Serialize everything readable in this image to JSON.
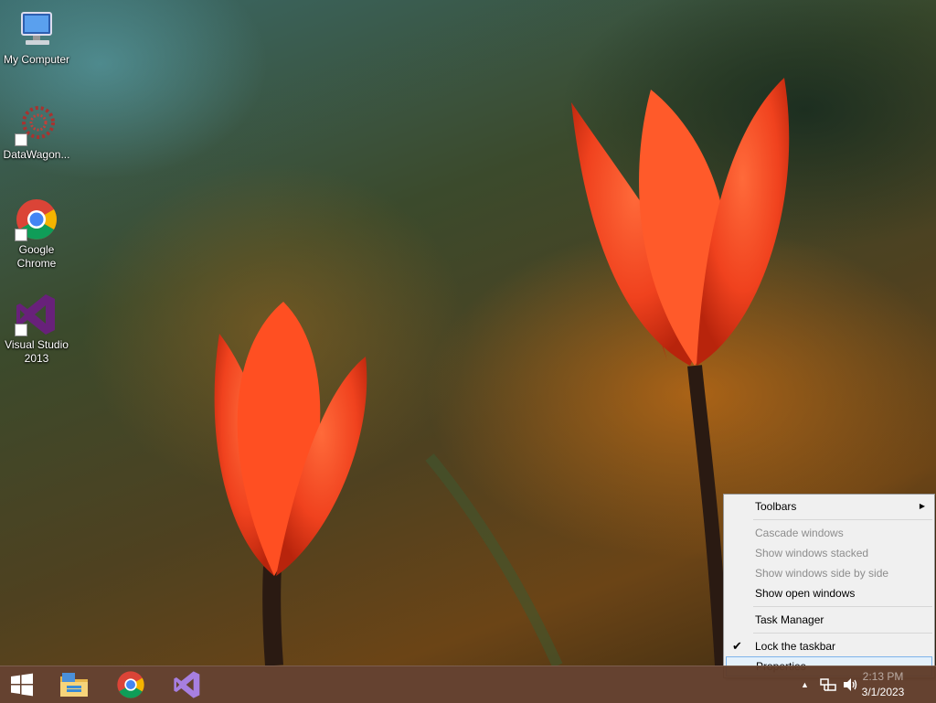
{
  "desktop": {
    "icons": [
      {
        "label": "My Computer"
      },
      {
        "label": "DataWagon..."
      },
      {
        "label": "Google Chrome"
      },
      {
        "label": "Visual Studio 2013"
      }
    ]
  },
  "context_menu": {
    "items": [
      {
        "label": "Toolbars",
        "enabled": true,
        "submenu": true
      },
      {
        "label": "Cascade windows",
        "enabled": false
      },
      {
        "label": "Show windows stacked",
        "enabled": false
      },
      {
        "label": "Show windows side by side",
        "enabled": false
      },
      {
        "label": "Show open windows",
        "enabled": true
      },
      {
        "label": "Task Manager",
        "enabled": true
      },
      {
        "label": "Lock the taskbar",
        "enabled": true,
        "checked": true
      },
      {
        "label": "Properties",
        "enabled": true,
        "highlighted": true
      }
    ]
  },
  "taskbar": {
    "pinned": [
      "start-icon",
      "file-explorer-icon",
      "chrome-icon",
      "visual-studio-icon"
    ],
    "clock": {
      "time": "2:13 PM",
      "date": "3/1/2023"
    }
  },
  "colors": {
    "taskbar": "#5f3a28",
    "menu_bg": "#f0f0f0",
    "menu_highlight": "#e5f1fb",
    "menu_highlight_border": "#7eb4ea",
    "chrome_red": "#db4437",
    "chrome_green": "#0f9d58",
    "chrome_yellow": "#f4b400",
    "chrome_blue": "#4285f4",
    "vs_purple": "#68217a"
  }
}
